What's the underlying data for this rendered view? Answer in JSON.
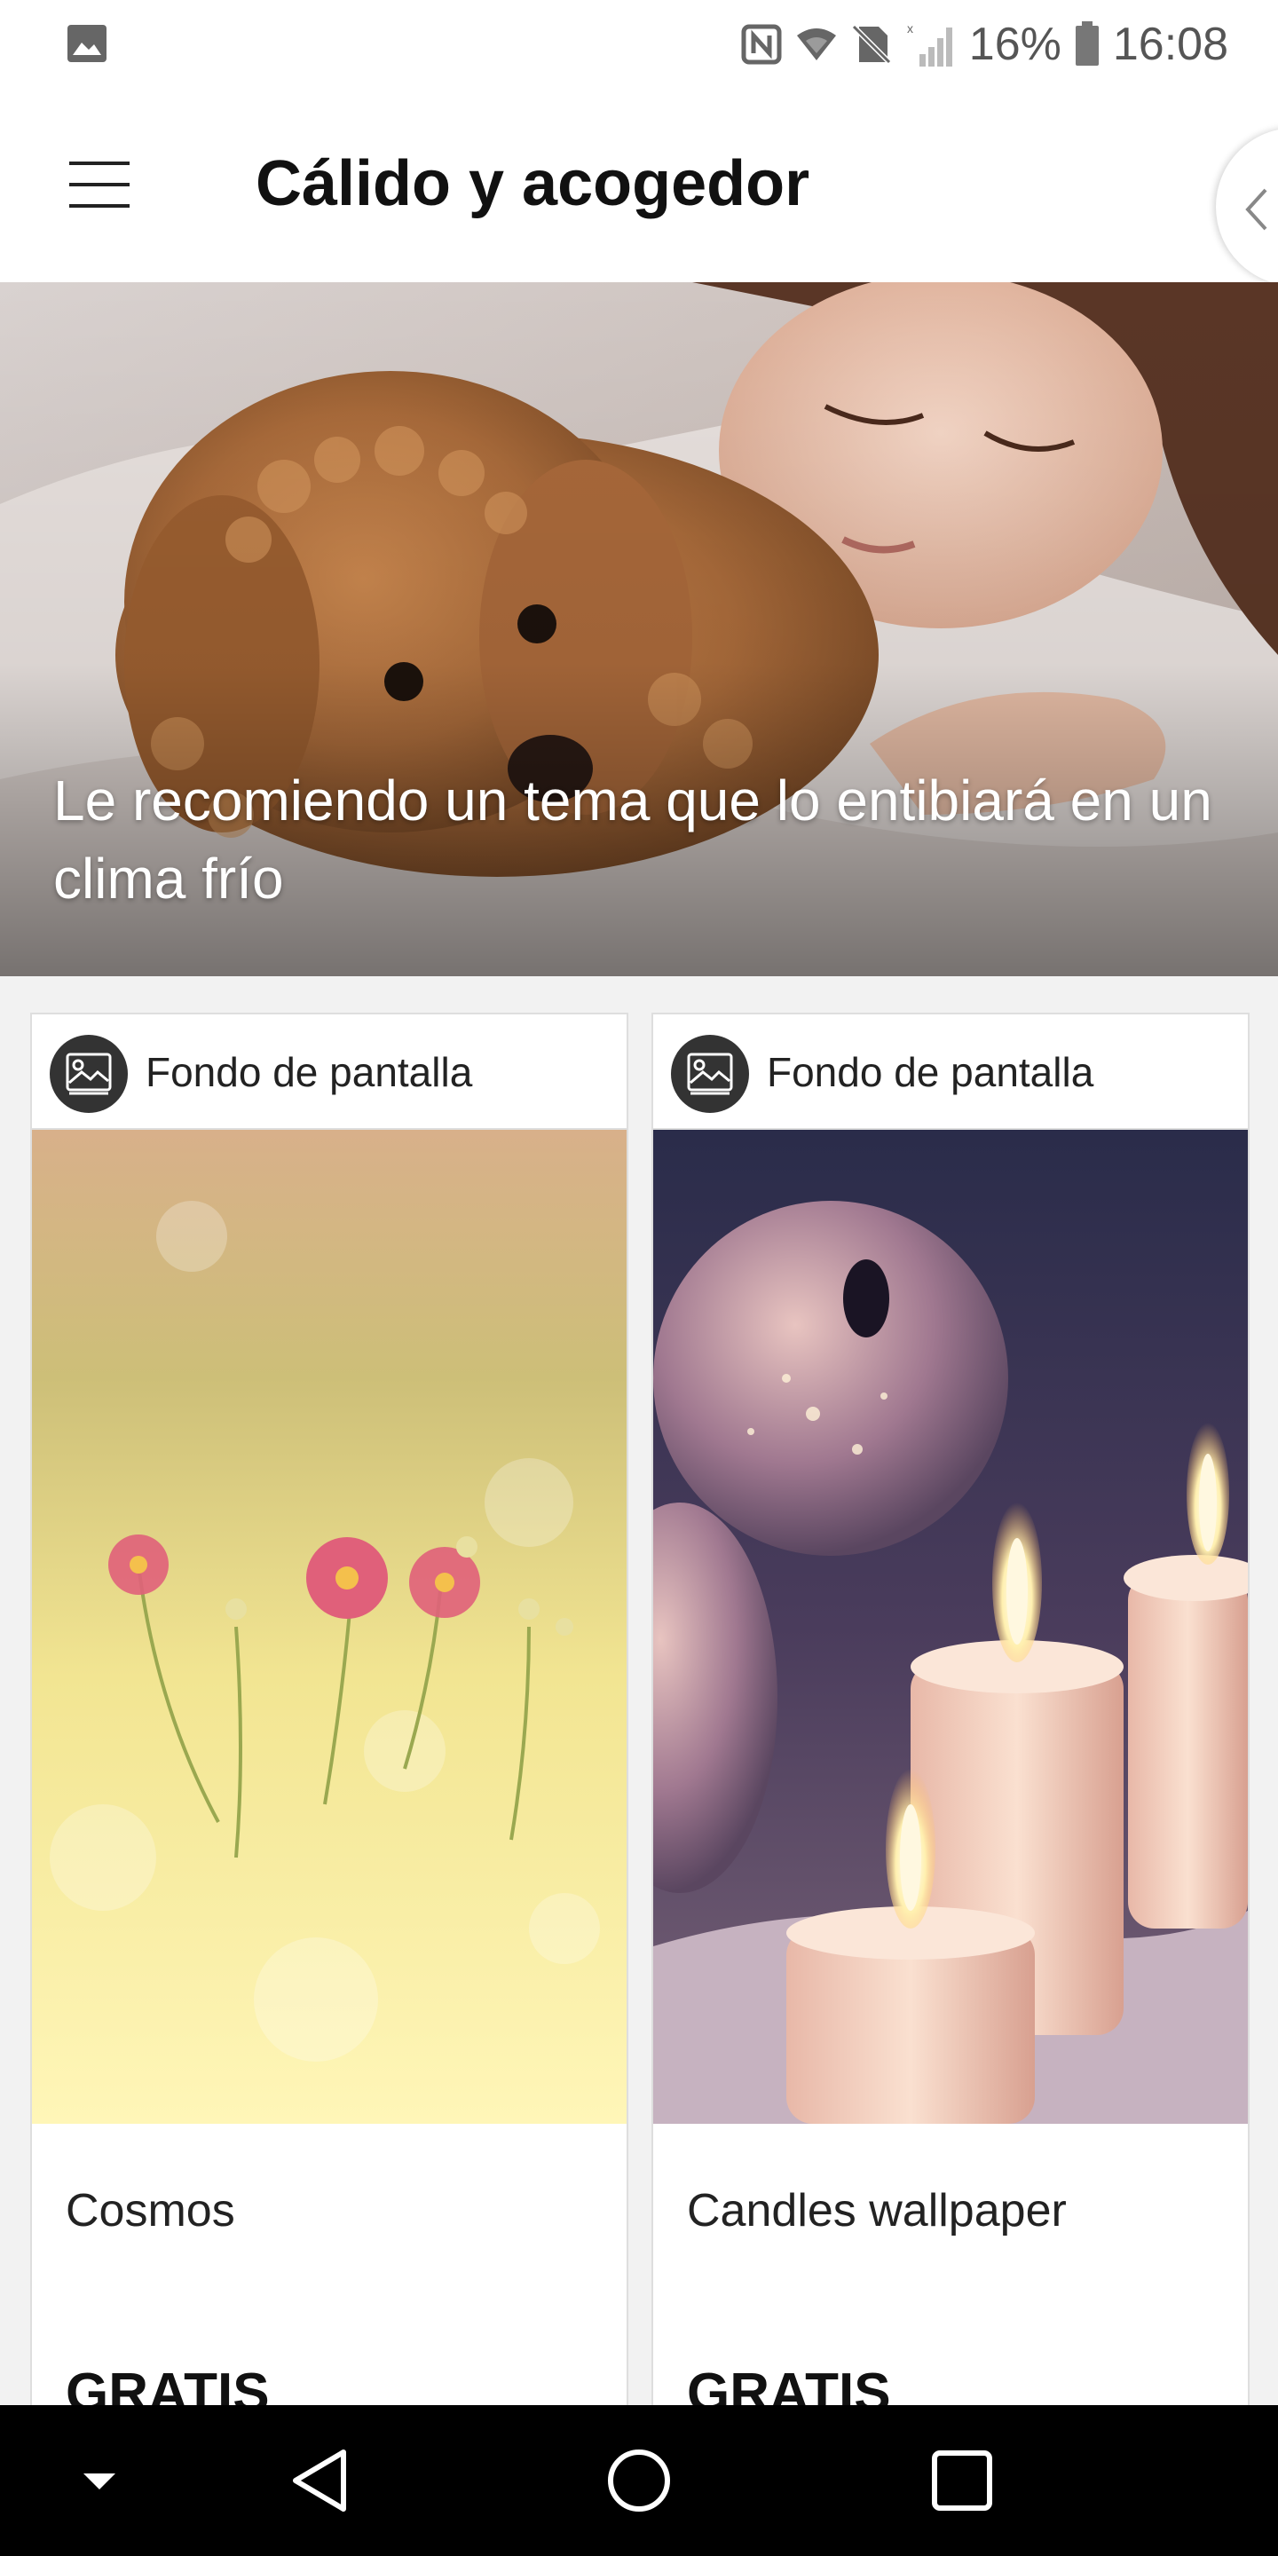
{
  "status_bar": {
    "battery": "16%",
    "time": "16:08",
    "icons": [
      "gallery-icon",
      "nfc-icon",
      "wifi-icon",
      "no-sim-icon",
      "signal-icon",
      "battery-icon"
    ]
  },
  "app_bar": {
    "title": "Cálido y acogedor",
    "menu_icon": "hamburger-menu-icon",
    "side_handle_icon": "chevron-left-icon"
  },
  "hero": {
    "caption": "Le recomiendo un tema que lo entibiará en un clima frío"
  },
  "cards": [
    {
      "type_label": "Fondo de pantalla",
      "type_icon": "wallpaper-type-icon",
      "name": "Cosmos",
      "price": "GRATIS"
    },
    {
      "type_label": "Fondo de pantalla",
      "type_icon": "wallpaper-type-icon",
      "name": "Candles wallpaper",
      "price": "GRATIS"
    }
  ],
  "nav_bar": {
    "icons": [
      "hide-keyboard-icon",
      "back-icon",
      "home-icon",
      "recents-icon"
    ]
  },
  "colors": {
    "status_text": "#555555",
    "title_text": "#111111",
    "nav_bar_bg": "#000000",
    "type_icon_bg": "#333333"
  }
}
